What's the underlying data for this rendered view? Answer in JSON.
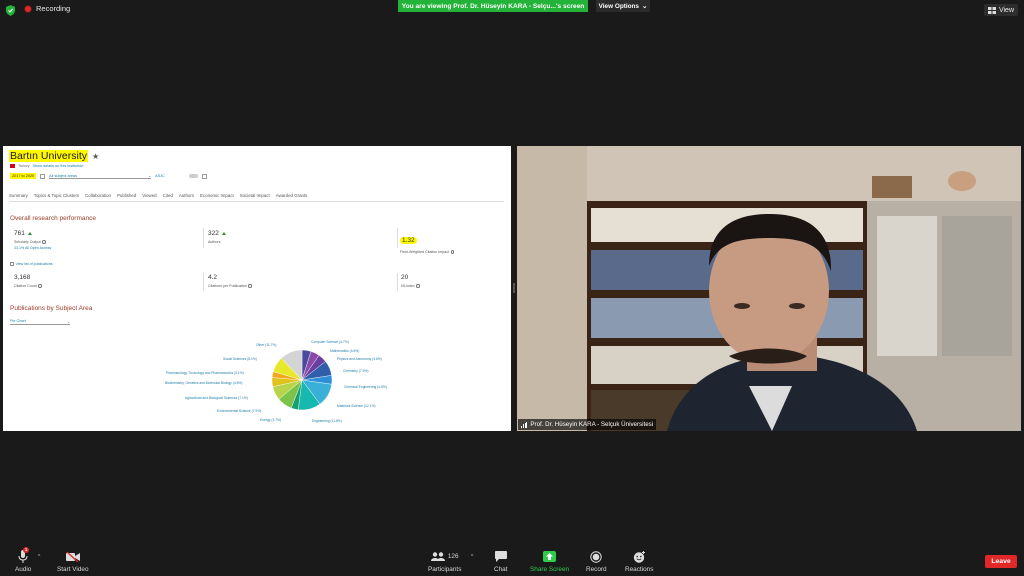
{
  "top": {
    "recording_label": "Recording",
    "banner": "You are viewing Prof. Dr. Hüseyin KARA - Selçu...'s screen",
    "view_options": "View Options",
    "view": "View"
  },
  "share": {
    "institution": "Bartın University",
    "country": "Turkey",
    "details_link": "Show details on this institution",
    "year_range": "2017 to 2020",
    "subject_filter": "All subject areas",
    "asjc": "ASJC",
    "tabs": [
      "Summary",
      "Topics & Topic Clusters",
      "Collaboration",
      "Published",
      "Viewed",
      "Cited",
      "Authors",
      "Economic Impact",
      "Societal Impact",
      "Awarded Grants"
    ],
    "section_title": "Overall research performance",
    "metrics": {
      "scholarly_output": {
        "value": "761",
        "label": "Scholarly Output",
        "sub": "33.1% All Open Access"
      },
      "authors": {
        "value": "322",
        "label": "Authors"
      },
      "fwci": {
        "value": "1.32",
        "label": "Field-Weighted Citation Impact"
      },
      "citation_count": {
        "value": "3,168",
        "label": "Citation Count"
      },
      "citations_per_pub": {
        "value": "4.2",
        "label": "Citations per Publication"
      },
      "h_index": {
        "value": "20",
        "label": "h5-index"
      }
    },
    "view_list": "View list of publications",
    "subject_title": "Publications by Subject Area",
    "chart_type_select": "Pie Chart",
    "pie_labels": {
      "other": "Other (11.7%)",
      "computer_science": "Computer Science (4.7%)",
      "mathematics": "Mathematics (4.6%)",
      "physics": "Physics and Astronomy (4.6%)",
      "chemistry": "Chemistry (7.9%)",
      "chem_eng": "Chemical Engineering (4.6%)",
      "materials": "Materials Science (12.1%)",
      "engineering": "Engineering (11.8%)",
      "energy": "Energy (3.7%)",
      "environmental": "Environmental Science (7.9%)",
      "agricultural": "Agricultural and Biological Sciences (7.1%)",
      "biochem": "Biochemistry, Genetics and Molecular Biology (4.8%)",
      "pharma": "Pharmacology, Toxicology and Pharmaceutics (3.1%)",
      "social": "Social Sciences (8.1%)"
    }
  },
  "chart_data": {
    "type": "pie",
    "categories": [
      "Computer Science",
      "Mathematics",
      "Physics and Astronomy",
      "Chemistry",
      "Chemical Engineering",
      "Materials Science",
      "Engineering",
      "Energy",
      "Environmental Science",
      "Agricultural and Biological Sciences",
      "Biochemistry, Genetics and Molecular Biology",
      "Pharmacology, Toxicology and Pharmaceutics",
      "Social Sciences",
      "Other"
    ],
    "values": [
      4.7,
      4.6,
      4.6,
      7.9,
      4.6,
      12.1,
      11.8,
      3.7,
      7.9,
      7.1,
      4.8,
      3.1,
      8.1,
      11.7
    ],
    "colors": [
      "#4a4a9e",
      "#8c4aa8",
      "#6a3fa0",
      "#2e5fa8",
      "#2f8fd6",
      "#3ab0d8",
      "#17b8b0",
      "#16a070",
      "#7cc34a",
      "#b8d44a",
      "#e0c21a",
      "#f2a81a",
      "#e8e82a",
      "#d4d4d4"
    ]
  },
  "video": {
    "participant_name": "Prof. Dr. Hüseyin KARA - Selçuk Üniversitesi"
  },
  "toolbar": {
    "audio": "Audio",
    "audio_badge": "1",
    "start_video": "Start Video",
    "participants": "Participants",
    "participants_count": "126",
    "chat": "Chat",
    "share_screen": "Share Screen",
    "record": "Record",
    "reactions": "Reactions",
    "leave": "Leave"
  }
}
